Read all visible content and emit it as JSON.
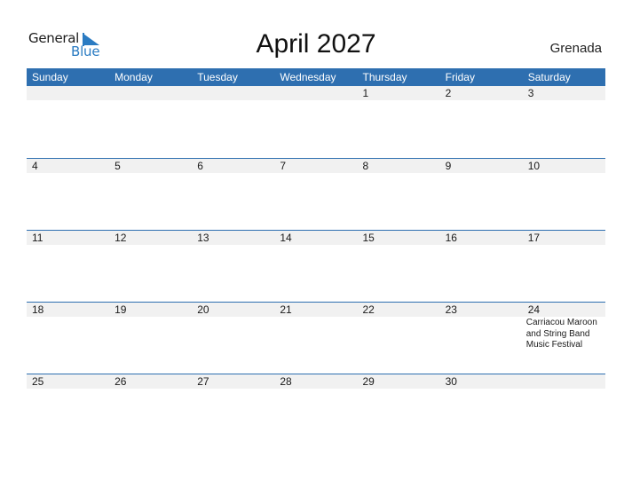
{
  "logo": {
    "general": "General",
    "blue": "Blue",
    "icon": "flag-triangle-icon",
    "brand_color": "#2a7bc2"
  },
  "title": "April 2027",
  "country": "Grenada",
  "colors": {
    "header_bg": "#2e6fb0",
    "header_text": "#ffffff",
    "day_strip_bg": "#f1f1f1"
  },
  "weekdays": [
    "Sunday",
    "Monday",
    "Tuesday",
    "Wednesday",
    "Thursday",
    "Friday",
    "Saturday"
  ],
  "weeks": [
    {
      "days": [
        "",
        "",
        "",
        "",
        "1",
        "2",
        "3"
      ],
      "events": [
        "",
        "",
        "",
        "",
        "",
        "",
        ""
      ]
    },
    {
      "days": [
        "4",
        "5",
        "6",
        "7",
        "8",
        "9",
        "10"
      ],
      "events": [
        "",
        "",
        "",
        "",
        "",
        "",
        ""
      ]
    },
    {
      "days": [
        "11",
        "12",
        "13",
        "14",
        "15",
        "16",
        "17"
      ],
      "events": [
        "",
        "",
        "",
        "",
        "",
        "",
        ""
      ]
    },
    {
      "days": [
        "18",
        "19",
        "20",
        "21",
        "22",
        "23",
        "24"
      ],
      "events": [
        "",
        "",
        "",
        "",
        "",
        "",
        "Carriacou Maroon and String Band Music Festival"
      ]
    },
    {
      "days": [
        "25",
        "26",
        "27",
        "28",
        "29",
        "30",
        ""
      ],
      "events": [
        "",
        "",
        "",
        "",
        "",
        "",
        ""
      ]
    }
  ]
}
